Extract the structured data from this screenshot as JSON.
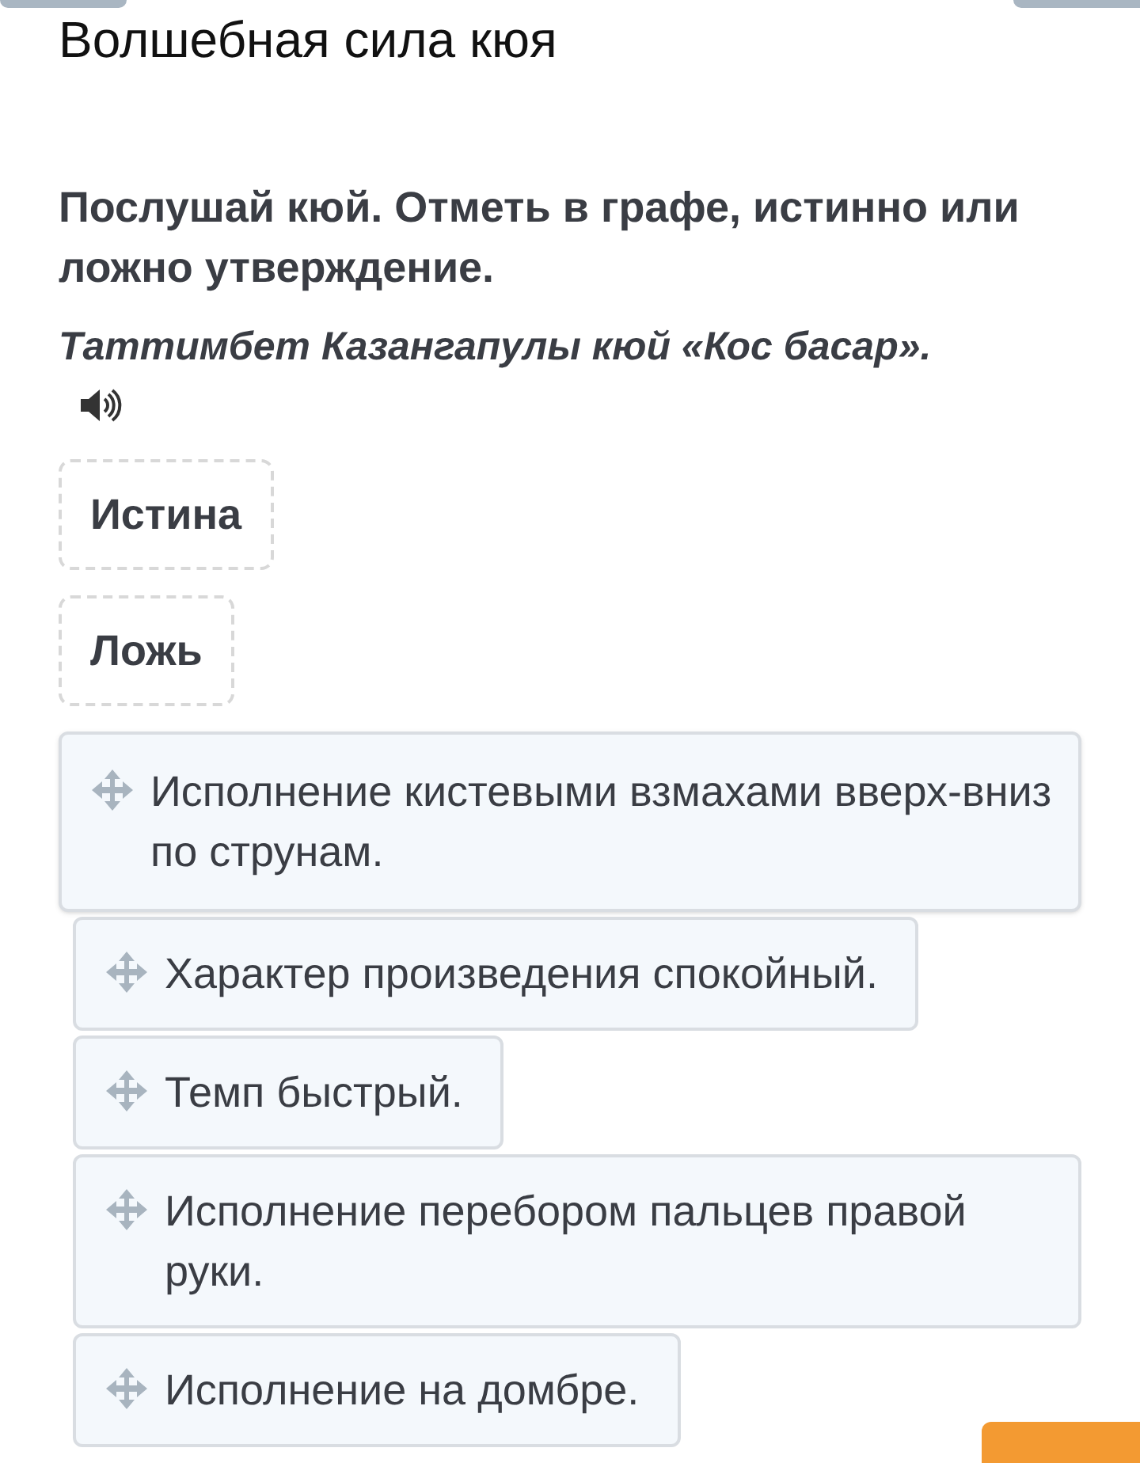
{
  "title": "Волшебная сила кюя",
  "question": "Послушай кюй. Отметь в графе, истинно или ложно утверждение.",
  "piece": "Таттимбет Казангапулы кюй «Кос басар».",
  "categories": [
    {
      "label": "Истина"
    },
    {
      "label": "Ложь"
    }
  ],
  "statements": [
    {
      "text": "Исполнение кистевыми взмахами вверх-вниз по струнам.",
      "dragging": true
    },
    {
      "text": "Характер произведения спокойный.",
      "dragging": false
    },
    {
      "text": "Темп быстрый.",
      "dragging": false
    },
    {
      "text": "Исполнение перебором пальцев правой руки.",
      "dragging": false
    },
    {
      "text": "Исполнение на домбре.",
      "dragging": false
    }
  ]
}
